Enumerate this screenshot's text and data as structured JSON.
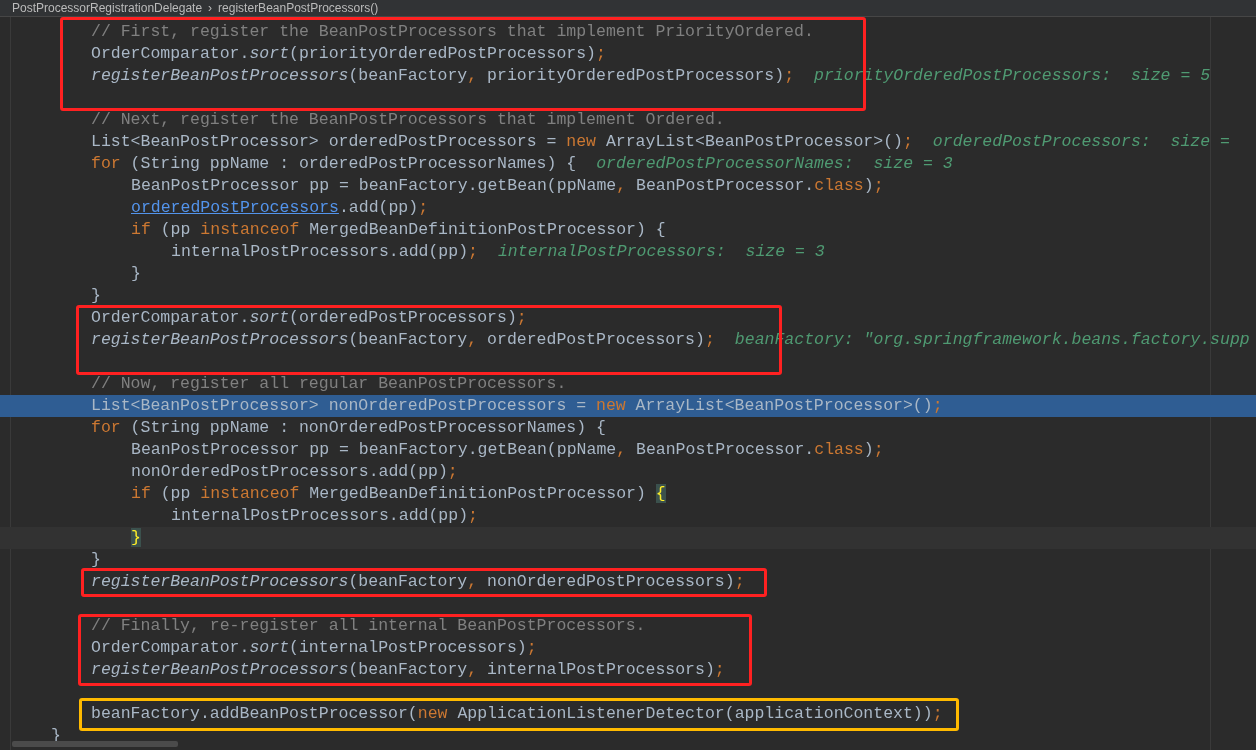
{
  "breadcrumbs": {
    "items": [
      "PostProcessorRegistrationDelegate",
      "registerBeanPostProcessors()"
    ],
    "separator": "›"
  },
  "blocks": [
    {
      "color": "#ff2121",
      "lines": [
        {
          "kind": "code",
          "tokens": [
            {
              "kind": "comment",
              "text": "// First, register the BeanPostProcessors that implement PriorityOrdered."
            }
          ]
        },
        {
          "kind": "code",
          "tokens": [
            {
              "kind": "plain",
              "text": "OrderComparator."
            },
            {
              "kind": "static",
              "text": "sort"
            },
            {
              "kind": "plain",
              "text": "(priorityOrderedPostProcessors)"
            },
            {
              "kind": "keyword",
              "text": ";"
            }
          ]
        },
        {
          "kind": "code",
          "tokens": [
            {
              "kind": "static",
              "text": "registerBeanPostProcessors"
            },
            {
              "kind": "plain",
              "text": "(beanFactory"
            },
            {
              "kind": "keyword",
              "text": ","
            },
            {
              "kind": "plain",
              "text": " priorityOrderedPostProcessors)"
            },
            {
              "kind": "keyword",
              "text": ";"
            }
          ],
          "hint": "priorityOrderedPostProcessors:  size = 5"
        },
        {
          "kind": "blank"
        }
      ]
    },
    {
      "lines": [
        {
          "kind": "code",
          "tokens": [
            {
              "kind": "comment",
              "text": "// Next, register the BeanPostProcessors that implement Ordered."
            }
          ]
        },
        {
          "kind": "code",
          "tokens": [
            {
              "kind": "plain",
              "text": "List<BeanPostProcessor> orderedPostProcessors = "
            },
            {
              "kind": "keyword",
              "text": "new"
            },
            {
              "kind": "plain",
              "text": " ArrayList<BeanPostProcessor>()"
            },
            {
              "kind": "keyword",
              "text": ";"
            }
          ],
          "hint": "orderedPostProcessors:  size ="
        },
        {
          "kind": "code",
          "tokens": [
            {
              "kind": "keyword",
              "text": "for"
            },
            {
              "kind": "plain",
              "text": " (String ppName : orderedPostProcessorNames) {"
            }
          ],
          "hint": "orderedPostProcessorNames:  size = 3",
          "children": [
            {
              "kind": "code",
              "tokens": [
                {
                  "kind": "plain",
                  "text": "BeanPostProcessor pp = beanFactory.getBean(ppName"
                },
                {
                  "kind": "keyword",
                  "text": ","
                },
                {
                  "kind": "plain",
                  "text": " BeanPostProcessor."
                },
                {
                  "kind": "keyword",
                  "text": "class"
                },
                {
                  "kind": "plain",
                  "text": ")"
                },
                {
                  "kind": "keyword",
                  "text": ";"
                }
              ]
            },
            {
              "kind": "code",
              "tokens": [
                {
                  "kind": "link",
                  "text": "orderedPostProcessors"
                },
                {
                  "kind": "plain",
                  "text": ".add(pp)"
                },
                {
                  "kind": "keyword",
                  "text": ";"
                }
              ]
            },
            {
              "kind": "code",
              "tokens": [
                {
                  "kind": "keyword",
                  "text": "if"
                },
                {
                  "kind": "plain",
                  "text": " (pp "
                },
                {
                  "kind": "keyword",
                  "text": "instanceof"
                },
                {
                  "kind": "plain",
                  "text": " MergedBeanDefinitionPostProcessor) {"
                }
              ],
              "children": [
                {
                  "kind": "code",
                  "tokens": [
                    {
                      "kind": "plain",
                      "text": "internalPostProcessors.add(pp)"
                    },
                    {
                      "kind": "keyword",
                      "text": ";"
                    }
                  ],
                  "hint": "internalPostProcessors:  size = 3"
                }
              ]
            },
            {
              "kind": "code",
              "tokens": [
                {
                  "kind": "plain",
                  "text": "}"
                }
              ]
            }
          ]
        },
        {
          "kind": "code",
          "tokens": [
            {
              "kind": "plain",
              "text": "}"
            }
          ]
        }
      ]
    },
    {
      "color": "#ff2121",
      "lines": [
        {
          "kind": "code",
          "tokens": [
            {
              "kind": "plain",
              "text": "OrderComparator."
            },
            {
              "kind": "static",
              "text": "sort"
            },
            {
              "kind": "plain",
              "text": "(orderedPostProcessors)"
            },
            {
              "kind": "keyword",
              "text": ";"
            }
          ]
        },
        {
          "kind": "code",
          "tokens": [
            {
              "kind": "static",
              "text": "registerBeanPostProcessors"
            },
            {
              "kind": "plain",
              "text": "(beanFactory"
            },
            {
              "kind": "keyword",
              "text": ","
            },
            {
              "kind": "plain",
              "text": " orderedPostProcessors)"
            },
            {
              "kind": "keyword",
              "text": ";"
            }
          ],
          "hint": "beanFactory: \"org.springframework.beans.factory.supp"
        },
        {
          "kind": "blank"
        }
      ]
    },
    {
      "lines": [
        {
          "kind": "code",
          "tokens": [
            {
              "kind": "comment",
              "text": "// Now, register all regular BeanPostProcessors."
            }
          ]
        },
        {
          "kind": "selected",
          "tokens": [
            {
              "kind": "plain",
              "text": "List<BeanPostProcessor> nonOrderedPostProcessors = "
            },
            {
              "kind": "keyword",
              "text": "new"
            },
            {
              "kind": "plain",
              "text": " ArrayList<BeanPostProcessor>()"
            },
            {
              "kind": "keyword",
              "text": ";"
            }
          ]
        },
        {
          "kind": "code",
          "tokens": [
            {
              "kind": "keyword",
              "text": "for"
            },
            {
              "kind": "plain",
              "text": " (String ppName : nonOrderedPostProcessorNames) {"
            }
          ],
          "children": [
            {
              "kind": "code",
              "tokens": [
                {
                  "kind": "plain",
                  "text": "BeanPostProcessor pp = beanFactory.getBean(ppName"
                },
                {
                  "kind": "keyword",
                  "text": ","
                },
                {
                  "kind": "plain",
                  "text": " BeanPostProcessor."
                },
                {
                  "kind": "keyword",
                  "text": "class"
                },
                {
                  "kind": "plain",
                  "text": ")"
                },
                {
                  "kind": "keyword",
                  "text": ";"
                }
              ]
            },
            {
              "kind": "code",
              "tokens": [
                {
                  "kind": "plain",
                  "text": "nonOrderedPostProcessors.add(pp)"
                },
                {
                  "kind": "keyword",
                  "text": ";"
                }
              ]
            },
            {
              "kind": "code",
              "tokens": [
                {
                  "kind": "keyword",
                  "text": "if"
                },
                {
                  "kind": "plain",
                  "text": " (pp "
                },
                {
                  "kind": "keyword",
                  "text": "instanceof"
                },
                {
                  "kind": "plain",
                  "text": " MergedBeanDefinitionPostProcessor) "
                },
                {
                  "kind": "brace",
                  "text": "{"
                }
              ],
              "children": [
                {
                  "kind": "code",
                  "tokens": [
                    {
                      "kind": "plain",
                      "text": "internalPostProcessors.add(pp)"
                    },
                    {
                      "kind": "keyword",
                      "text": ";"
                    }
                  ]
                }
              ]
            },
            {
              "kind": "caret",
              "tokens": [
                {
                  "kind": "brace",
                  "text": "}"
                }
              ]
            }
          ]
        },
        {
          "kind": "code",
          "tokens": [
            {
              "kind": "plain",
              "text": "}"
            }
          ]
        }
      ]
    },
    {
      "color": "#ff2121",
      "lines": [
        {
          "kind": "code",
          "tokens": [
            {
              "kind": "static",
              "text": "registerBeanPostProcessors"
            },
            {
              "kind": "plain",
              "text": "(beanFactory"
            },
            {
              "kind": "keyword",
              "text": ","
            },
            {
              "kind": "plain",
              "text": " nonOrderedPostProcessors)"
            },
            {
              "kind": "keyword",
              "text": ";"
            }
          ]
        }
      ]
    },
    {
      "lines": [
        {
          "kind": "blank"
        }
      ]
    },
    {
      "color": "#ff2121",
      "lines": [
        {
          "kind": "code",
          "tokens": [
            {
              "kind": "comment",
              "text": "// Finally, re-register all internal BeanPostProcessors."
            }
          ]
        },
        {
          "kind": "code",
          "tokens": [
            {
              "kind": "plain",
              "text": "OrderComparator."
            },
            {
              "kind": "static",
              "text": "sort"
            },
            {
              "kind": "plain",
              "text": "(internalPostProcessors)"
            },
            {
              "kind": "keyword",
              "text": ";"
            }
          ]
        },
        {
          "kind": "code",
          "tokens": [
            {
              "kind": "static",
              "text": "registerBeanPostProcessors"
            },
            {
              "kind": "plain",
              "text": "(beanFactory"
            },
            {
              "kind": "keyword",
              "text": ","
            },
            {
              "kind": "plain",
              "text": " internalPostProcessors)"
            },
            {
              "kind": "keyword",
              "text": ";"
            }
          ]
        }
      ]
    },
    {
      "lines": [
        {
          "kind": "blank"
        }
      ]
    },
    {
      "color": "#ffba00",
      "lines": [
        {
          "kind": "code",
          "tokens": [
            {
              "kind": "plain",
              "text": "beanFactory.addBeanPostProcessor("
            },
            {
              "kind": "keyword",
              "text": "new"
            },
            {
              "kind": "plain",
              "text": " ApplicationListenerDetector(applicationContext))"
            },
            {
              "kind": "keyword",
              "text": ";"
            }
          ]
        }
      ]
    }
  ],
  "closing_line": {
    "kind": "code",
    "tokens": [
      {
        "kind": "plain",
        "text": "}"
      }
    ]
  }
}
